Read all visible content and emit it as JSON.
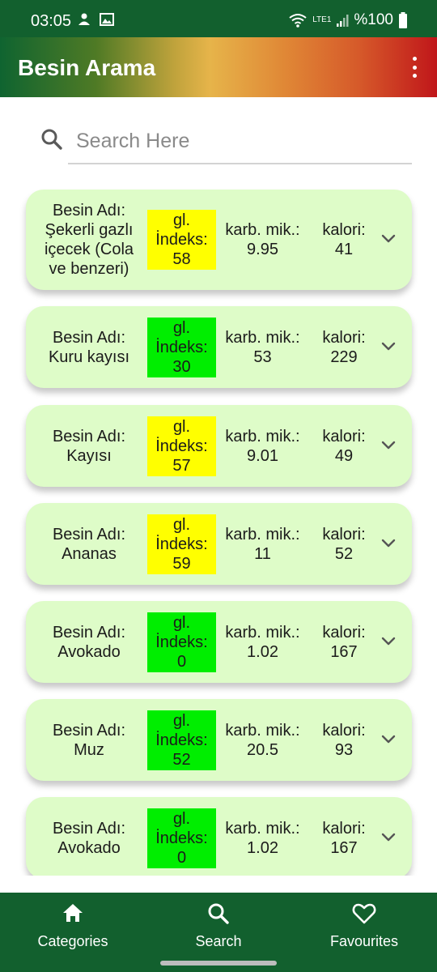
{
  "status_bar": {
    "time": "03:05",
    "network": "LTE1",
    "battery_text": "%100"
  },
  "app_bar": {
    "title": "Besin Arama"
  },
  "search": {
    "placeholder": "Search Here",
    "value": ""
  },
  "labels": {
    "name_prefix": "Besin Adı:",
    "gi_label_line1": "gl.",
    "gi_label_line2": "İndeks:",
    "carb_label": "karb. mik.:",
    "cal_label": "kalori:"
  },
  "colors": {
    "gi_high": "#ffff00",
    "gi_low": "#00ee00",
    "card_bg": "#defcc8",
    "nav_bg": "#12602e"
  },
  "foods": [
    {
      "name": "Şekerli gazlı içecek (Cola ve benzeri)",
      "gi": "58",
      "carb": "9.95",
      "cal": "41",
      "gi_level": "high"
    },
    {
      "name": "Kuru kayısı",
      "gi": "30",
      "carb": "53",
      "cal": "229",
      "gi_level": "low"
    },
    {
      "name": "Kayısı",
      "gi": "57",
      "carb": "9.01",
      "cal": "49",
      "gi_level": "high"
    },
    {
      "name": "Ananas",
      "gi": "59",
      "carb": "11",
      "cal": "52",
      "gi_level": "high"
    },
    {
      "name": "Avokado",
      "gi": "0",
      "carb": "1.02",
      "cal": "167",
      "gi_level": "low"
    },
    {
      "name": "Muz",
      "gi": "52",
      "carb": "20.5",
      "cal": "93",
      "gi_level": "low"
    },
    {
      "name": "Avokado",
      "gi": "0",
      "carb": "1.02",
      "cal": "167",
      "gi_level": "low"
    }
  ],
  "bottom_nav": [
    {
      "label": "Categories",
      "icon": "home-icon"
    },
    {
      "label": "Search",
      "icon": "search-icon"
    },
    {
      "label": "Favourites",
      "icon": "heart-icon"
    }
  ]
}
